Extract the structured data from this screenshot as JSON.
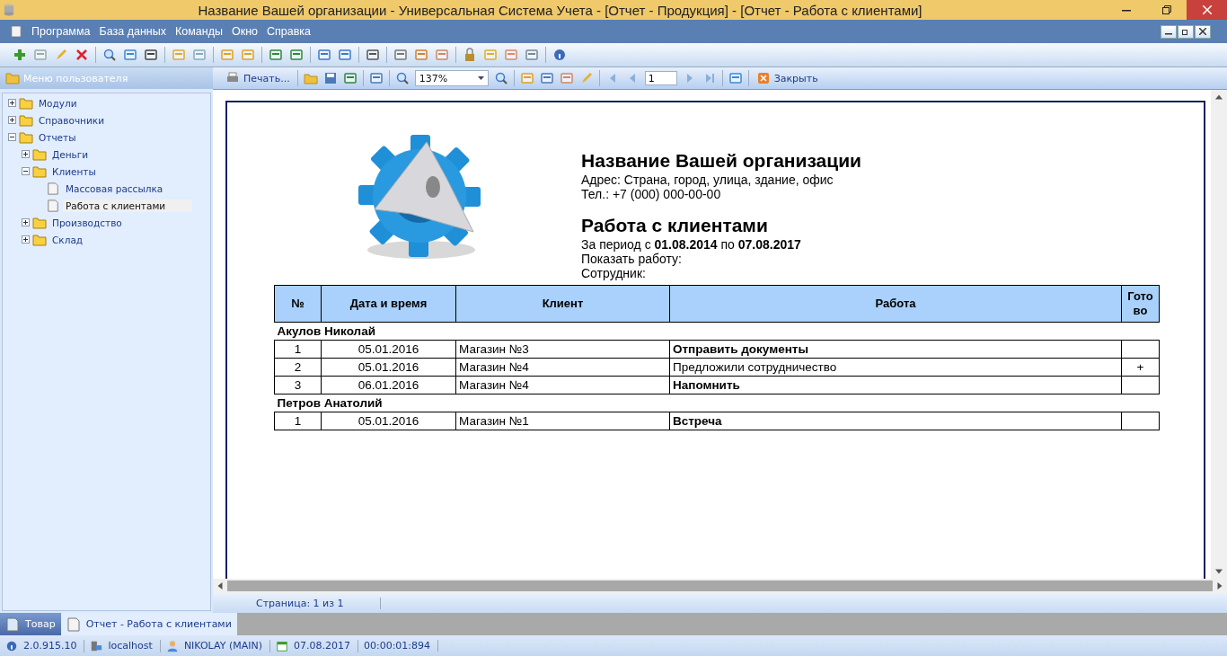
{
  "window": {
    "title": "Название Вашей организации - Универсальная Система Учета - [Отчет - Продукция] - [Отчет - Работа с клиентами]"
  },
  "menu": [
    "Программа",
    "База данных",
    "Команды",
    "Окно",
    "Справка"
  ],
  "sidebar": {
    "title": "Меню пользователя",
    "tree": [
      {
        "label": "Модули",
        "expanded": false,
        "selected": false,
        "kind": "folder"
      },
      {
        "label": "Справочники",
        "expanded": false,
        "selected": false,
        "kind": "folder"
      },
      {
        "label": "Отчеты",
        "expanded": true,
        "selected": false,
        "kind": "folder",
        "children": [
          {
            "label": "Деньги",
            "expanded": false,
            "selected": false,
            "kind": "folder"
          },
          {
            "label": "Клиенты",
            "expanded": true,
            "selected": false,
            "kind": "folder",
            "children": [
              {
                "label": "Массовая рассылка",
                "selected": false,
                "kind": "report"
              },
              {
                "label": "Работа с клиентами",
                "selected": true,
                "kind": "report"
              }
            ]
          },
          {
            "label": "Производство",
            "expanded": false,
            "selected": false,
            "kind": "folder"
          },
          {
            "label": "Склад",
            "expanded": false,
            "selected": false,
            "kind": "folder"
          }
        ]
      }
    ]
  },
  "report_toolbar": {
    "print": "Печать...",
    "zoom": "137%",
    "page": "1",
    "close": "Закрыть"
  },
  "report": {
    "org_name": "Название Вашей организации",
    "address": "Адрес: Страна, город, улица, здание, офис",
    "phone": "Тел.: +7 (000) 000-00-00",
    "title": "Работа с клиентами",
    "period": "За период  с **01.08.2014** по **07.08.2017**",
    "show_work": "Показать работу:",
    "employee": "Сотрудник:",
    "columns": [
      "№",
      "Дата и время",
      "Клиент",
      "Работа",
      "Гото во"
    ],
    "groups": [
      {
        "name": "Акулов Николай",
        "rows": [
          {
            "no": "1",
            "date": "05.01.2016",
            "client": "Магазин №3",
            "work": "Отправить документы",
            "emphasis": true,
            "done": ""
          },
          {
            "no": "2",
            "date": "05.01.2016",
            "client": "Магазин №4",
            "work": "Предложили сотрудничество",
            "emphasis": false,
            "done": "+"
          },
          {
            "no": "3",
            "date": "06.01.2016",
            "client": "Магазин №4",
            "work": "Напомнить",
            "emphasis": true,
            "done": ""
          }
        ]
      },
      {
        "name": "Петров Анатолий",
        "rows": [
          {
            "no": "1",
            "date": "05.01.2016",
            "client": "Магазин №1",
            "work": "Встреча",
            "emphasis": true,
            "done": ""
          }
        ]
      }
    ]
  },
  "page_status": "Страница: 1 из 1",
  "doc_tabs": [
    {
      "label": "Товар",
      "selected": false
    },
    {
      "label": "Отчет - Работа с клиентами",
      "selected": true
    }
  ],
  "status_bar": {
    "version": "2.0.915.10",
    "server": "localhost",
    "user": "NIKOLAY (MAIN)",
    "date": "07.08.2017",
    "timer": "00:00:01:894"
  }
}
